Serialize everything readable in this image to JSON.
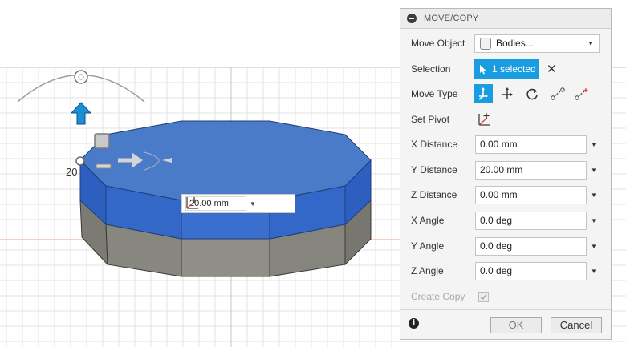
{
  "viewport": {
    "ruler_value": "20",
    "inline_distance": "20.00 mm",
    "colors": {
      "top_face": "#4a7bc9",
      "side_upper": "#2f62c1",
      "side_lower": "#7b7b73",
      "manipulator_blue": "#1b8ed6"
    }
  },
  "panel": {
    "title": "MOVE/COPY",
    "rows": {
      "move_object": {
        "label": "Move Object",
        "value": "Bodies..."
      },
      "selection": {
        "label": "Selection",
        "value": "1 selected"
      },
      "move_type": {
        "label": "Move Type"
      },
      "set_pivot": {
        "label": "Set Pivot"
      },
      "x_distance": {
        "label": "X Distance",
        "value": "0.00 mm"
      },
      "y_distance": {
        "label": "Y Distance",
        "value": "20.00 mm"
      },
      "z_distance": {
        "label": "Z Distance",
        "value": "0.00 mm"
      },
      "x_angle": {
        "label": "X Angle",
        "value": "0.0 deg"
      },
      "y_angle": {
        "label": "Y Angle",
        "value": "0.0 deg"
      },
      "z_angle": {
        "label": "Z Angle",
        "value": "0.0 deg"
      },
      "create_copy": {
        "label": "Create Copy",
        "checked": true,
        "disabled": true
      }
    },
    "move_type_icons": [
      "free-move-icon",
      "translate-icon",
      "rotate-icon",
      "point-to-point-icon",
      "point-to-position-icon"
    ],
    "buttons": {
      "ok": "OK",
      "cancel": "Cancel"
    },
    "accent": "#1a9de0"
  }
}
